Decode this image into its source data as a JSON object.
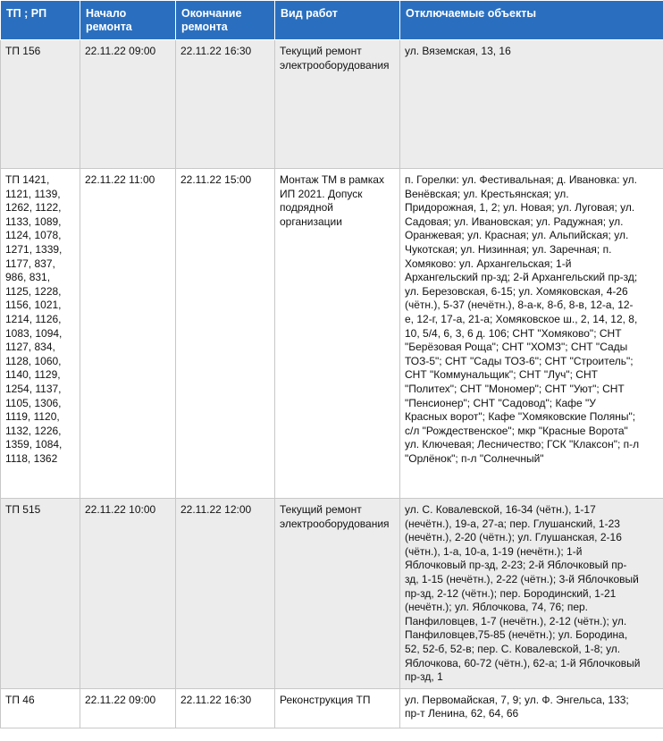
{
  "table": {
    "headers": [
      "ТП ; РП",
      "Начало\nремонта",
      "Окончание\nремонта",
      "Вид работ",
      "Отключаемые объекты"
    ],
    "rows": [
      {
        "tp": "ТП 156",
        "start": "22.11.22 09:00",
        "end": "22.11.22 16:30",
        "work": "Текущий ремонт\nэлектрооборудования",
        "objects": "ул. Вяземская, 13, 16"
      },
      {
        "tp": "ТП 1421,\n1121, 1139,\n1262, 1122,\n1133, 1089,\n1124, 1078,\n1271, 1339,\n1177, 837,\n986, 831,\n1125, 1228,\n1156, 1021,\n1214, 1126,\n1083, 1094,\n1127, 834,\n1128, 1060,\n1140, 1129,\n1254, 1137,\n1105, 1306,\n1119, 1120,\n1132, 1226,\n1359, 1084,\n1118, 1362",
        "start": "22.11.22 11:00",
        "end": "22.11.22 15:00",
        "work": "Монтаж ТМ в рамках\nИП 2021. Допуск\nподрядной\nорганизации",
        "objects": "п. Горелки: ул. Фестивальная; д. Ивановка: ул.\nВенёвская; ул. Крестьянская; ул.\nПридорожная, 1, 2; ул. Новая; ул. Луговая; ул.\nСадовая; ул. Ивановская; ул. Радужная; ул.\nОранжевая; ул. Красная; ул. Альпийская; ул.\nЧукотская; ул. Низинная; ул. Заречная;  п.\nХомяково: ул. Архангельская; 1-й\nАрхангельский пр-зд; 2-й Архангельский пр-зд;\nул. Березовская, 6-15; ул. Хомяковская, 4-26\n(чётн.), 5-37 (нечётн.), 8-а-к, 8-б, 8-в, 12-а, 12-\nе, 12-г, 17-а, 21-а; Хомяковское ш., 2, 14, 12, 8,\n10, 5/4, 6, 3, 6 д. 106; СНТ \"Хомяково\"; СНТ\n\"Берёзовая Роща\"; СНТ \"ХОМЗ\"; СНТ \"Сады\nТОЗ-5\"; СНТ \"Сады ТОЗ-6\"; СНТ \"Строитель\";\nСНТ \"Коммунальщик\"; СНТ \"Луч\"; СНТ\n\"Политех\"; СНТ \"Мономер\"; СНТ \"Уют\"; СНТ\n\"Пенсионер\"; СНТ \"Садовод\"; Кафе \"У\nКрасных ворот\"; Кафе \"Хомяковские Поляны\";\nс/л \"Рождественское\"; мкр \"Красные Ворота\"\nул. Ключевая; Лесничество; ГСК \"Клаксон\"; п-л\n\"Орлёнок\"; п-л \"Солнечный\""
      },
      {
        "tp": "ТП 515",
        "start": "22.11.22 10:00",
        "end": "22.11.22 12:00",
        "work": "Текущий ремонт\nэлектрооборудования",
        "objects": "ул. С. Ковалевской, 16-34 (чётн.), 1-17\n(нечётн.), 19-а, 27-а; пер. Глушанский, 1-23\n(нечётн.), 2-20 (чётн.); ул. Глушанская, 2-16\n(чётн.), 1-а, 10-а, 1-19 (нечётн.); 1-й\nЯблочковый пр-зд, 2-23; 2-й Яблочковый пр-\nзд, 1-15 (нечётн.), 2-22 (чётн.); 3-й Яблочковый\nпр-зд, 2-12 (чётн.); пер. Бородинский, 1-21\n(нечётн.); ул. Яблочкова, 74, 76; пер.\nПанфиловцев, 1-7 (нечётн.), 2-12 (чётн.); ул.\nПанфиловцев,75-85 (нечётн.); ул. Бородина,\n52, 52-б, 52-в; пер. С. Ковалевской, 1-8;  ул.\nЯблочкова, 60-72 (чётн.), 62-а; 1-й Яблочковый\nпр-зд, 1"
      },
      {
        "tp": "ТП 46",
        "start": "22.11.22 09:00",
        "end": "22.11.22 16:30",
        "work": "Реконструкция ТП",
        "objects": "ул. Первомайская, 7, 9; ул. Ф. Энгельса, 133;\nпр-т Ленина, 62, 64, 66"
      }
    ]
  }
}
